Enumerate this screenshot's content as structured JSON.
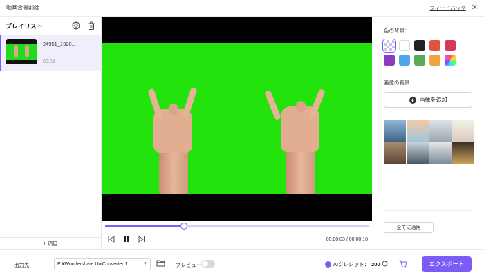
{
  "window": {
    "title": "動画背景削除",
    "feedback_link": "フィードバック",
    "close_glyph": "✕"
  },
  "playlist": {
    "title": "プレイリスト",
    "items": [
      {
        "name": "24951_1920...",
        "duration": "00:09"
      }
    ],
    "count_text": "1 項目"
  },
  "player": {
    "progress_fraction": 0.3,
    "current_time": "00:00:03",
    "total_time": "00:00:10",
    "time_separator": " / "
  },
  "background": {
    "color_label": "色の背景：",
    "colors": [
      "transparent",
      "#ffffff",
      "#222222",
      "#e0533f",
      "#d9375e",
      "#8d3bc2",
      "#4fa6ee",
      "#5aab58",
      "#f2a33a",
      "rainbow"
    ],
    "selected_index": 0,
    "image_label": "画像の背景：",
    "add_image_button": "画像を追加",
    "images": [
      {
        "name": "snowy-mountains",
        "c1": "#8fb6d8",
        "c2": "#3f6382"
      },
      {
        "name": "beach-sunset",
        "c1": "#f3c9a6",
        "c2": "#9ec8d8"
      },
      {
        "name": "grey-clouds",
        "c1": "#dfe3e8",
        "c2": "#9aa6b1"
      },
      {
        "name": "white-room",
        "c1": "#f2efe9",
        "c2": "#d9cbbb"
      },
      {
        "name": "living-room",
        "c1": "#a58a70",
        "c2": "#5b4636"
      },
      {
        "name": "office-window",
        "c1": "#c8d1d8",
        "c2": "#4a5a66"
      },
      {
        "name": "modern-lobby",
        "c1": "#e6e6e6",
        "c2": "#7d8b95"
      },
      {
        "name": "bokeh-lights",
        "c1": "#3a3224",
        "c2": "#c9a05b"
      }
    ],
    "apply_all_button": "全てに適用"
  },
  "footer": {
    "output_label": "出力先:",
    "output_path": "E:¥Wondershare UniConverter 1",
    "preview_label": "プレビュー",
    "preview_on": false,
    "credit_label": "AIクレジット：",
    "credit_value": "200",
    "export_button": "エクスポート"
  },
  "colors": {
    "accent": "#7b5cf6",
    "chroma_green": "#22e30c"
  }
}
